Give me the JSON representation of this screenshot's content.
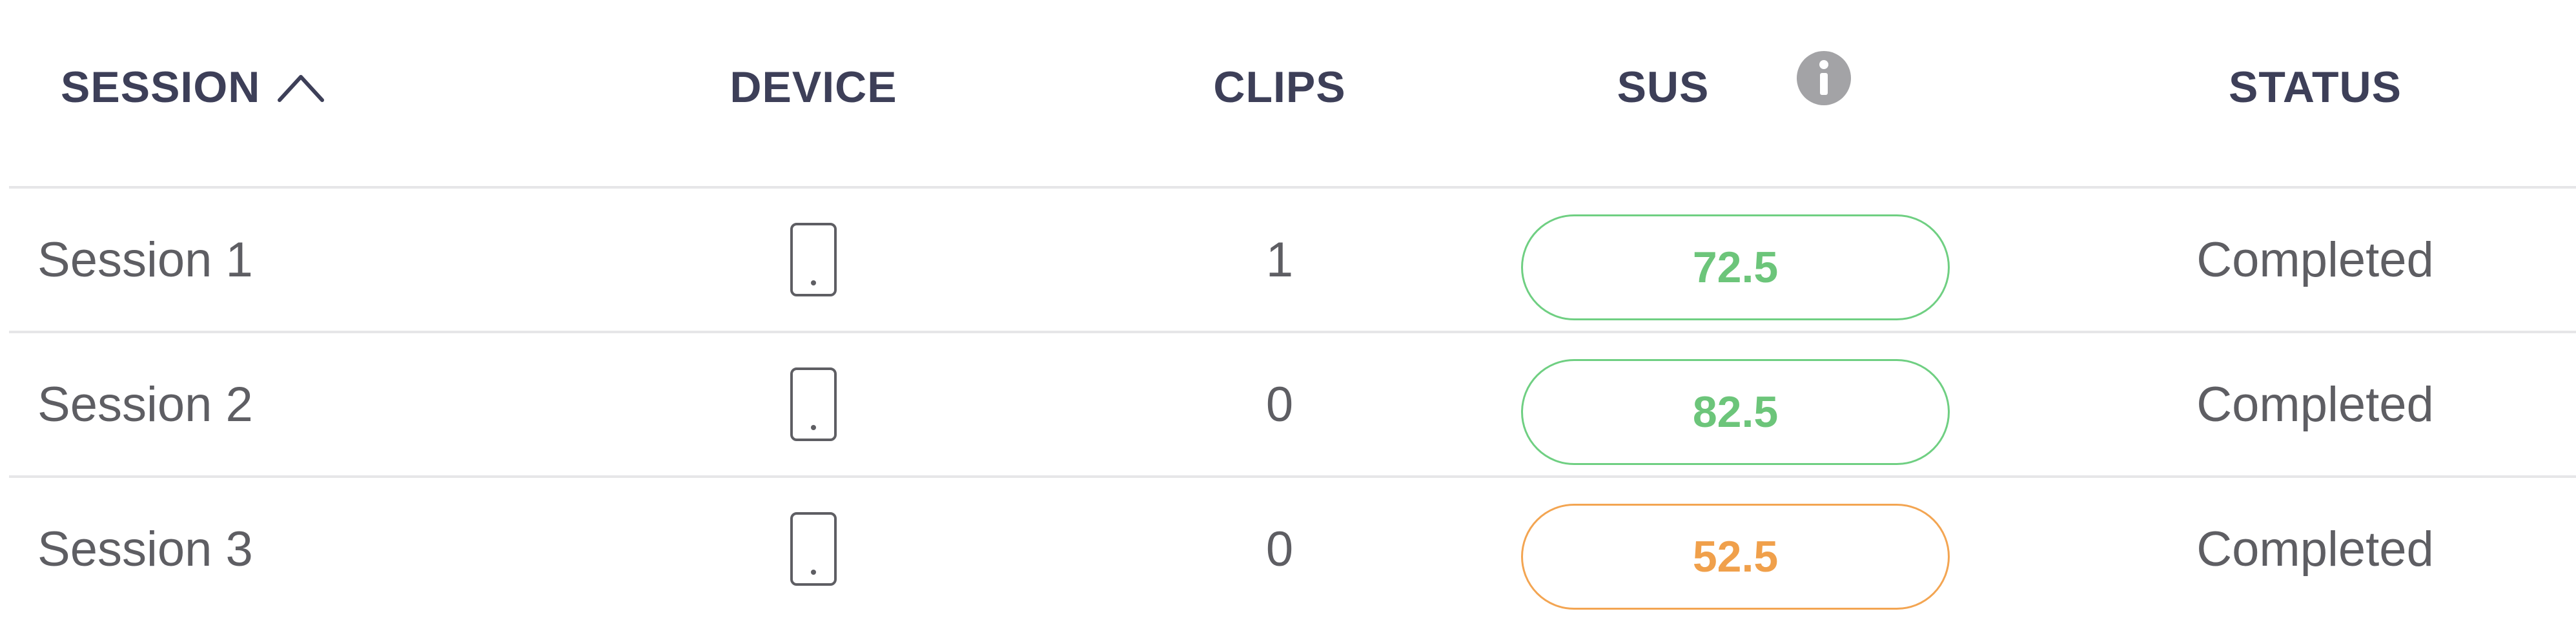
{
  "table": {
    "headers": {
      "session": "SESSION",
      "device": "DEVICE",
      "clips": "CLIPS",
      "sus": "SUS",
      "status": "STATUS"
    },
    "sort": {
      "column": "session",
      "direction": "ascending",
      "icon": "chevron-up-icon"
    },
    "sus_info_icon": "info-icon",
    "rows": [
      {
        "session": "Session 1",
        "device_icon": "phone-icon",
        "clips": "1",
        "sus": "72.5",
        "sus_color": "#6cc57a",
        "status": "Completed"
      },
      {
        "session": "Session 2",
        "device_icon": "phone-icon",
        "clips": "0",
        "sus": "82.5",
        "sus_color": "#6cc57a",
        "status": "Completed"
      },
      {
        "session": "Session 3",
        "device_icon": "phone-icon",
        "clips": "0",
        "sus": "52.5",
        "sus_color": "#f0a04b",
        "status": "Completed"
      }
    ]
  },
  "colors": {
    "header_text": "#3d3f58",
    "body_text": "#5e5e63",
    "divider": "#e6e6e8",
    "sus_good": "#6cc57a",
    "sus_ok": "#f0a04b",
    "icon_gray": "#a3a3a6"
  }
}
